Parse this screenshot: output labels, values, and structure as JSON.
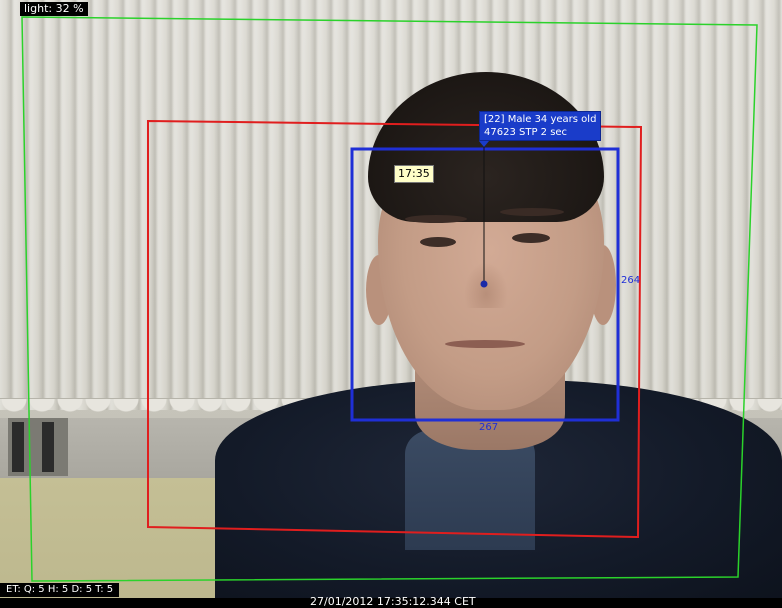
{
  "overlay": {
    "light": "light: 32 %",
    "face_tag_line1": "[22] Male 34 years old",
    "face_tag_line2": "47623 STP 2 sec",
    "time_tag": "17:35",
    "face_width": "267",
    "face_height": "264",
    "status_bar": "ET:  Q: 5  H: 5  D: 5  T: 5",
    "timestamp": "27/01/2012 17:35:12.344 CET"
  },
  "colors": {
    "outer_zone": "#2bd22b",
    "detection_zone": "#e01e1e",
    "face_box": "#1f2fd6",
    "tag_bg": "#1a3cc9"
  }
}
